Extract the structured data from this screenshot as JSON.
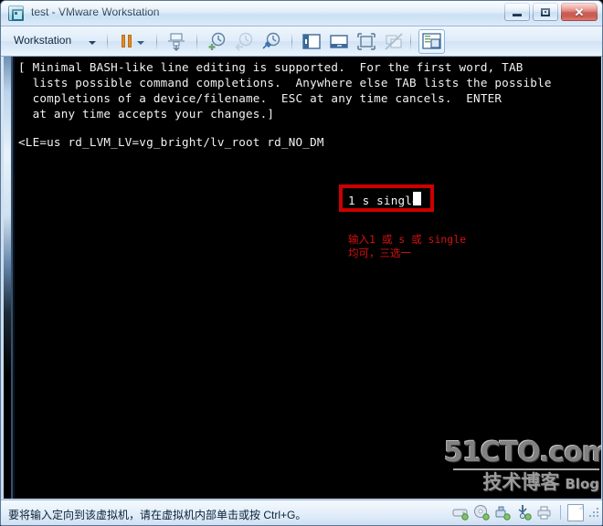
{
  "window": {
    "title": "test - VMware Workstation",
    "app_icon": "vmware-logo-icon",
    "buttons": {
      "minimize": "minimize-button",
      "maximize": "maximize-button",
      "close_label": "✕"
    }
  },
  "toolbar": {
    "menu_label": "Workstation",
    "items": [
      {
        "name": "pause-button",
        "label": "Pause"
      },
      {
        "name": "pause-dropdown",
        "label": "Pause options"
      },
      {
        "name": "send-ctrl-alt-del-button",
        "label": "Send Ctrl+Alt+Del"
      },
      {
        "name": "take-snapshot-button",
        "label": "Take snapshot"
      },
      {
        "name": "revert-snapshot-button",
        "label": "Revert to snapshot"
      },
      {
        "name": "manage-snapshots-button",
        "label": "Manage snapshots"
      },
      {
        "name": "show-library-button",
        "label": "Show or hide library"
      },
      {
        "name": "show-thumbnail-bar-button",
        "label": "Show or hide thumbnail bar"
      },
      {
        "name": "enter-fullscreen-button",
        "label": "Enter full screen"
      },
      {
        "name": "unity-mode-button",
        "label": "Unity mode"
      },
      {
        "name": "console-view-button",
        "label": "Console view"
      }
    ]
  },
  "vm_screen": {
    "terminal_block_1": "[ Minimal BASH-like line editing is supported.  For the first word, TAB\n  lists possible command completions.  Anywhere else TAB lists the possible\n  completions of a device/filename.  ESC at any time cancels.  ENTER\n  at any time accepts your changes.]",
    "command_line_prefix": "<LE=us rd_LVM_LV=vg_bright/lv_root rd_NO_DM ",
    "highlighted_input": "1 s single",
    "cursor": "block-cursor",
    "annotation_line_1": "输入1 或 s 或 single",
    "annotation_line_2": "均可，三选一",
    "highlight_color": "#cc0000",
    "annotation_color": "#d41111",
    "watermark": {
      "main": "51CTO.com",
      "sub": "技术博客",
      "blog": "Blog"
    }
  },
  "statusbar": {
    "message": "要将输入定向到该虚拟机，请在虚拟机内部单击或按 Ctrl+G。",
    "devices": [
      {
        "name": "hard-disk-icon",
        "label": "Hard Disk"
      },
      {
        "name": "cd-dvd-icon",
        "label": "CD/DVD"
      },
      {
        "name": "network-adapter-icon",
        "label": "Network Adapter"
      },
      {
        "name": "usb-controller-icon",
        "label": "USB"
      },
      {
        "name": "printer-icon",
        "label": "Printer"
      }
    ]
  }
}
